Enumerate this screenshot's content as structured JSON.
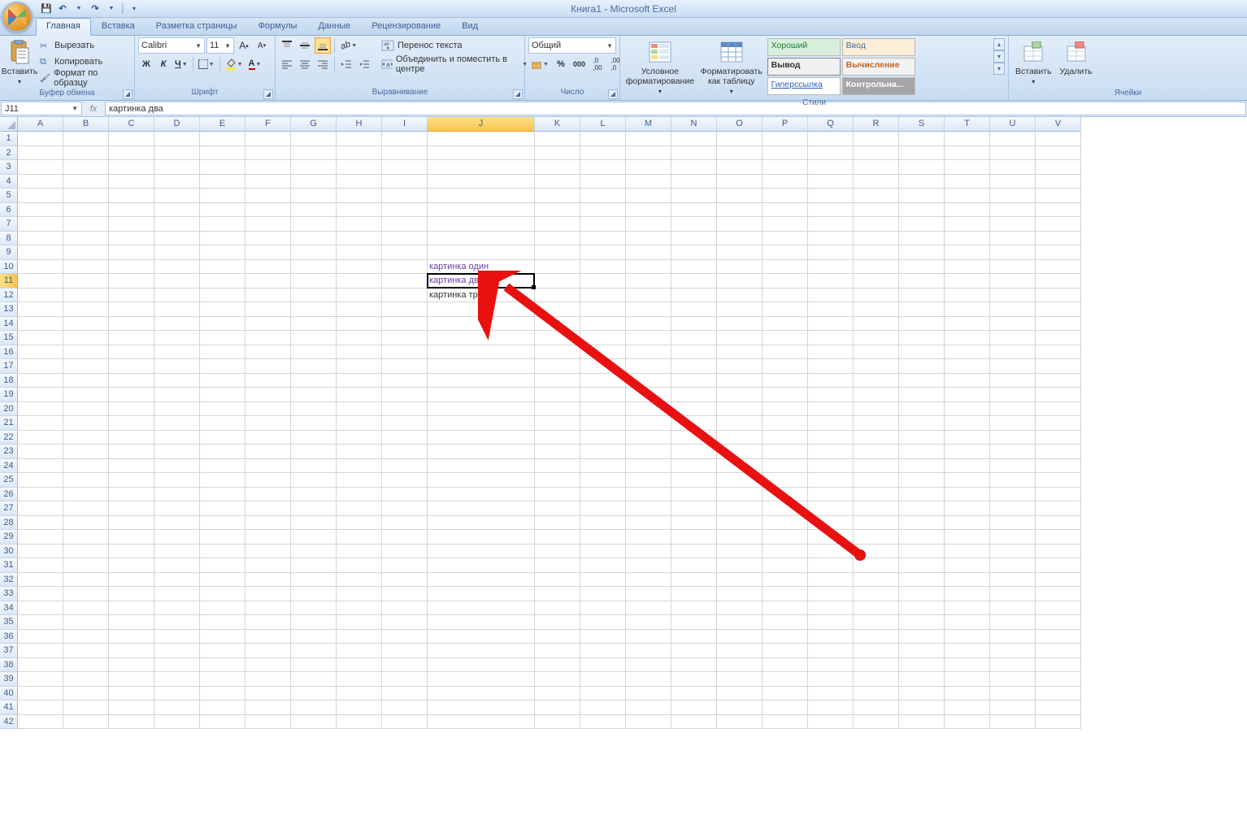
{
  "title": "Книга1 - Microsoft Excel",
  "qat": {
    "save": "Сохранить",
    "undo": "Отменить",
    "redo": "Вернуть"
  },
  "tabs": [
    "Главная",
    "Вставка",
    "Разметка страницы",
    "Формулы",
    "Данные",
    "Рецензирование",
    "Вид"
  ],
  "activeTab": 0,
  "ribbon": {
    "clipboard": {
      "label": "Буфер обмена",
      "paste": "Вставить",
      "cut": "Вырезать",
      "copy": "Копировать",
      "formatPainter": "Формат по образцу"
    },
    "font": {
      "label": "Шрифт",
      "name": "Calibri",
      "size": "11",
      "bold": "Ж",
      "italic": "К",
      "underline": "Ч",
      "grow": "A",
      "shrink": "A"
    },
    "alignment": {
      "label": "Выравнивание",
      "wrap": "Перенос текста",
      "merge": "Объединить и поместить в центре"
    },
    "number": {
      "label": "Число",
      "format": "Общий"
    },
    "styles": {
      "label": "Стили",
      "condFmt": "Условное\nформатирование",
      "asTable": "Форматировать\nкак таблицу",
      "cells": [
        {
          "t": "Хороший",
          "c": "#1e7a34",
          "bg": "#d8efdc"
        },
        {
          "t": "Ввод",
          "c": "#3f6ea5",
          "bg": "#fcedd6",
          "bd": "#b8b8b8"
        },
        {
          "t": "Вывод",
          "c": "#333",
          "bg": "#f0f0f0",
          "bd": "#888",
          "b": true
        },
        {
          "t": "Вычисление",
          "c": "#c0662a",
          "bg": "#f2f2f2",
          "bd": "#b8b8b8",
          "b": true
        },
        {
          "t": "Гиперссылка",
          "c": "#2b5fc1",
          "bg": "#fff",
          "u": true
        },
        {
          "t": "Контрольна...",
          "c": "#fff",
          "bg": "#a6a6a6",
          "b": true
        }
      ]
    },
    "cellsGrp": {
      "label": "Ячейки",
      "insert": "Вставить",
      "delete": "Удалить"
    }
  },
  "formulaBar": {
    "nameBox": "J11",
    "formula": "картинка два"
  },
  "columns": [
    "A",
    "B",
    "C",
    "D",
    "E",
    "F",
    "G",
    "H",
    "I",
    "J",
    "K",
    "L",
    "M",
    "N",
    "O",
    "P",
    "Q",
    "R",
    "S",
    "T",
    "U",
    "V"
  ],
  "colWidths": {
    "default": 56,
    "J": 132
  },
  "activeCol": "J",
  "activeRow": 11,
  "rowCount": 42,
  "cellData": {
    "J10": {
      "v": "картинка один",
      "link": true
    },
    "J11": {
      "v": "картинка два",
      "link": true
    },
    "J12": {
      "v": "картинка три"
    }
  }
}
